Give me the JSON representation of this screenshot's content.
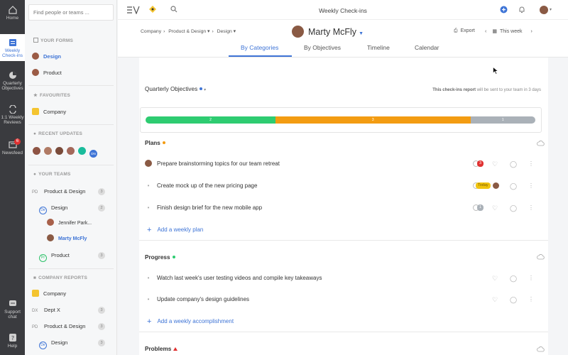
{
  "rail": {
    "items": [
      {
        "label": "Home",
        "icon": "home-icon"
      },
      {
        "label": "Weekly Check-ins",
        "icon": "checkins-icon"
      },
      {
        "label": "Quarterly Objectives",
        "icon": "objectives-icon"
      },
      {
        "label": "1:1 Weekly Reviews",
        "icon": "reviews-icon"
      },
      {
        "label": "Newsfeed",
        "icon": "newsfeed-icon",
        "badge": "6"
      },
      {
        "label": "Support chat",
        "icon": "chat-icon"
      },
      {
        "label": "Help",
        "icon": "help-icon"
      }
    ]
  },
  "sidebar": {
    "search_placeholder": "Find people or teams ...",
    "your_forms_title": "YOUR FORMS",
    "forms": [
      {
        "label": "Design"
      },
      {
        "label": "Product"
      }
    ],
    "favourites_title": "FAVOURITES",
    "favourites": [
      {
        "label": "Company"
      }
    ],
    "recent_title": "RECENT UPDATES",
    "recent_last": "DN",
    "your_teams_title": "YOUR TEAMS",
    "teams": [
      {
        "initials": "PD",
        "label": "Product & Design",
        "count": "3"
      },
      {
        "initials": "De",
        "label": "Design",
        "count": "2"
      },
      {
        "label": "Jennifer Park..."
      },
      {
        "label": "Marty McFly"
      },
      {
        "initials": "Pr",
        "label": "Product",
        "count": "3"
      }
    ],
    "reports_title": "COMPANY REPORTS",
    "reports": [
      {
        "label": "Company"
      },
      {
        "initials": "DX",
        "label": "Dept X",
        "count": "3"
      },
      {
        "initials": "PD",
        "label": "Product & Design",
        "count": "3"
      },
      {
        "initials": "De",
        "label": "Design",
        "count": "3"
      }
    ]
  },
  "topbar": {
    "title": "Weekly Check-ins"
  },
  "subhead": {
    "crumbs": [
      "Company",
      "Product & Design ▾",
      "Design ▾"
    ],
    "person": "Marty McFly",
    "export": "Export",
    "week": "This week",
    "tabs": [
      "By Categories",
      "By Objectives",
      "Timeline",
      "Calendar"
    ]
  },
  "main": {
    "objectives_title": "Quarterly Objectives",
    "report_note_bold": "This check-ins report",
    "report_note_rest": " will be sent to your team in 3 days",
    "progress_segments": [
      {
        "value": 2,
        "label": "2",
        "color": "#2ecc71"
      },
      {
        "value": 3,
        "label": "3",
        "color": "#f39c12"
      },
      {
        "value": 1,
        "label": "1",
        "color": "#aab1b8"
      }
    ],
    "plans_title": "Plans",
    "plans": [
      {
        "text": "Prepare brainstorming topics for our team retreat",
        "pill": "3 d",
        "pill_color": "#e03131"
      },
      {
        "text": "Create mock up of the new pricing page",
        "pill": "Today",
        "pill_color": "#f1c40f"
      },
      {
        "text": "Finish design brief for the new mobile app",
        "pill": "1 d",
        "pill_color": "#aab1b8"
      }
    ],
    "add_plan": "Add a weekly plan",
    "progress_title": "Progress",
    "progress_items": [
      {
        "text": "Watch last week's user testing videos and compile key takeaways"
      },
      {
        "text": "Update company's design guidelines"
      }
    ],
    "add_accomplishment": "Add a weekly accomplishment",
    "problems_title": "Problems"
  }
}
